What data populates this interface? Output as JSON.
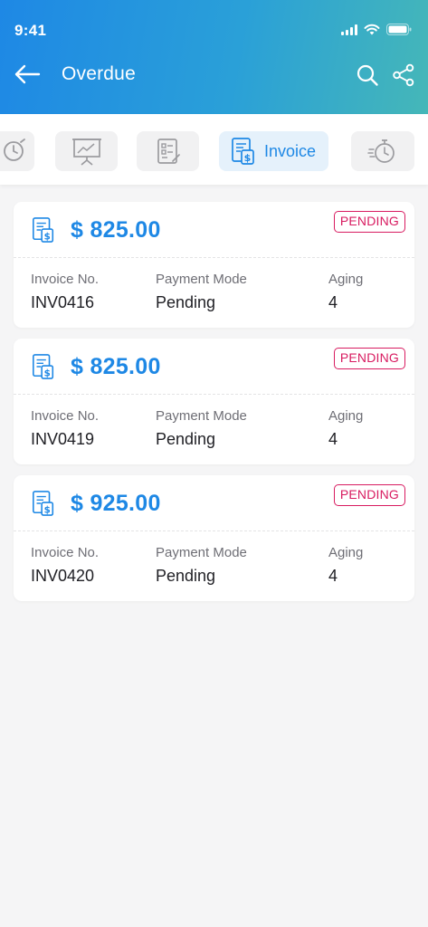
{
  "status_bar": {
    "time": "9:41"
  },
  "header": {
    "title": "Overdue"
  },
  "tabs": [
    {
      "name": "timer",
      "icon": "clock-icon",
      "active": false
    },
    {
      "name": "presentation",
      "icon": "presentation-board-icon",
      "active": false
    },
    {
      "name": "form",
      "icon": "form-checklist-icon",
      "active": false
    },
    {
      "name": "invoice",
      "icon": "invoice-icon",
      "label": "Invoice",
      "active": true
    },
    {
      "name": "stopwatch",
      "icon": "stopwatch-icon",
      "active": false
    }
  ],
  "labels": {
    "invoice_no": "Invoice No.",
    "payment_mode": "Payment Mode",
    "aging": "Aging"
  },
  "invoices": [
    {
      "amount": "$ 825.00",
      "status": "PENDING",
      "invoice_no": "INV0416",
      "payment_mode": "Pending",
      "aging": "4"
    },
    {
      "amount": "$ 825.00",
      "status": "PENDING",
      "invoice_no": "INV0419",
      "payment_mode": "Pending",
      "aging": "4"
    },
    {
      "amount": "$ 925.00",
      "status": "PENDING",
      "invoice_no": "INV0420",
      "payment_mode": "Pending",
      "aging": "4"
    }
  ],
  "colors": {
    "accent": "#1e88e5",
    "header_gradient_end": "#45b7b8",
    "status_pending": "#d81b60",
    "background": "#f5f5f6"
  }
}
